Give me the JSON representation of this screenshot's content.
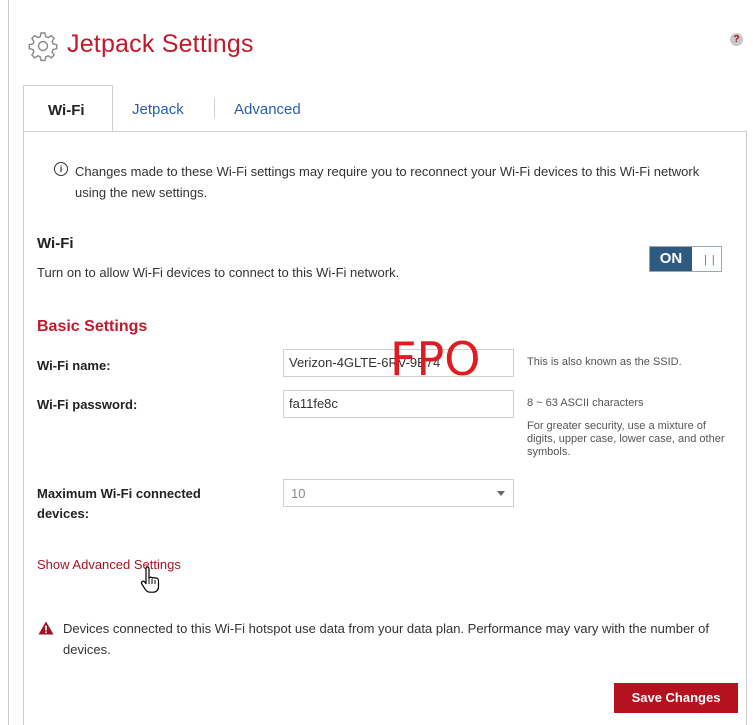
{
  "header": {
    "title": "Jetpack Settings",
    "icon": "gear-icon",
    "help_label": "?"
  },
  "tabs": [
    {
      "label": "Wi-Fi",
      "active": true
    },
    {
      "label": "Jetpack",
      "active": false
    },
    {
      "label": "Advanced",
      "active": false
    }
  ],
  "info_notice": {
    "icon": "info-icon",
    "text": "Changes made to these Wi-Fi settings may require you to reconnect your Wi-Fi devices to this Wi-Fi network using the new settings."
  },
  "wifi_section": {
    "heading": "Wi-Fi",
    "description": "Turn on to allow Wi-Fi devices to connect to this Wi-Fi network.",
    "toggle_label": "ON",
    "toggle_state": "on"
  },
  "basic_settings": {
    "heading": "Basic Settings",
    "wifi_name_label": "Wi-Fi name:",
    "wifi_name_value": "Verizon-4GLTE-6RV-9B74",
    "wifi_name_hint": "This is also known as the SSID.",
    "wifi_password_label": "Wi-Fi password:",
    "wifi_password_value": "fa11fe8c",
    "password_hint": "8 ~ 63 ASCII characters",
    "password_security_hint": "For greater security, use a mixture of digits, upper case, lower case, and other symbols.",
    "max_devices_label": "Maximum Wi-Fi connected devices:",
    "max_devices_value": "10",
    "placeholder_overlay": "FPO"
  },
  "advanced_link": "Show Advanced Settings",
  "warning_notice": {
    "icon": "warning-icon",
    "text": "Devices connected to this Wi-Fi hotspot use data from your data plan. Performance may vary with the number of devices."
  },
  "save_button": "Save Changes",
  "colors": {
    "brand_red": "#c01a2c",
    "link_blue": "#2a5db0",
    "toggle_blue": "#2f5a80",
    "button_red": "#b5111f"
  }
}
